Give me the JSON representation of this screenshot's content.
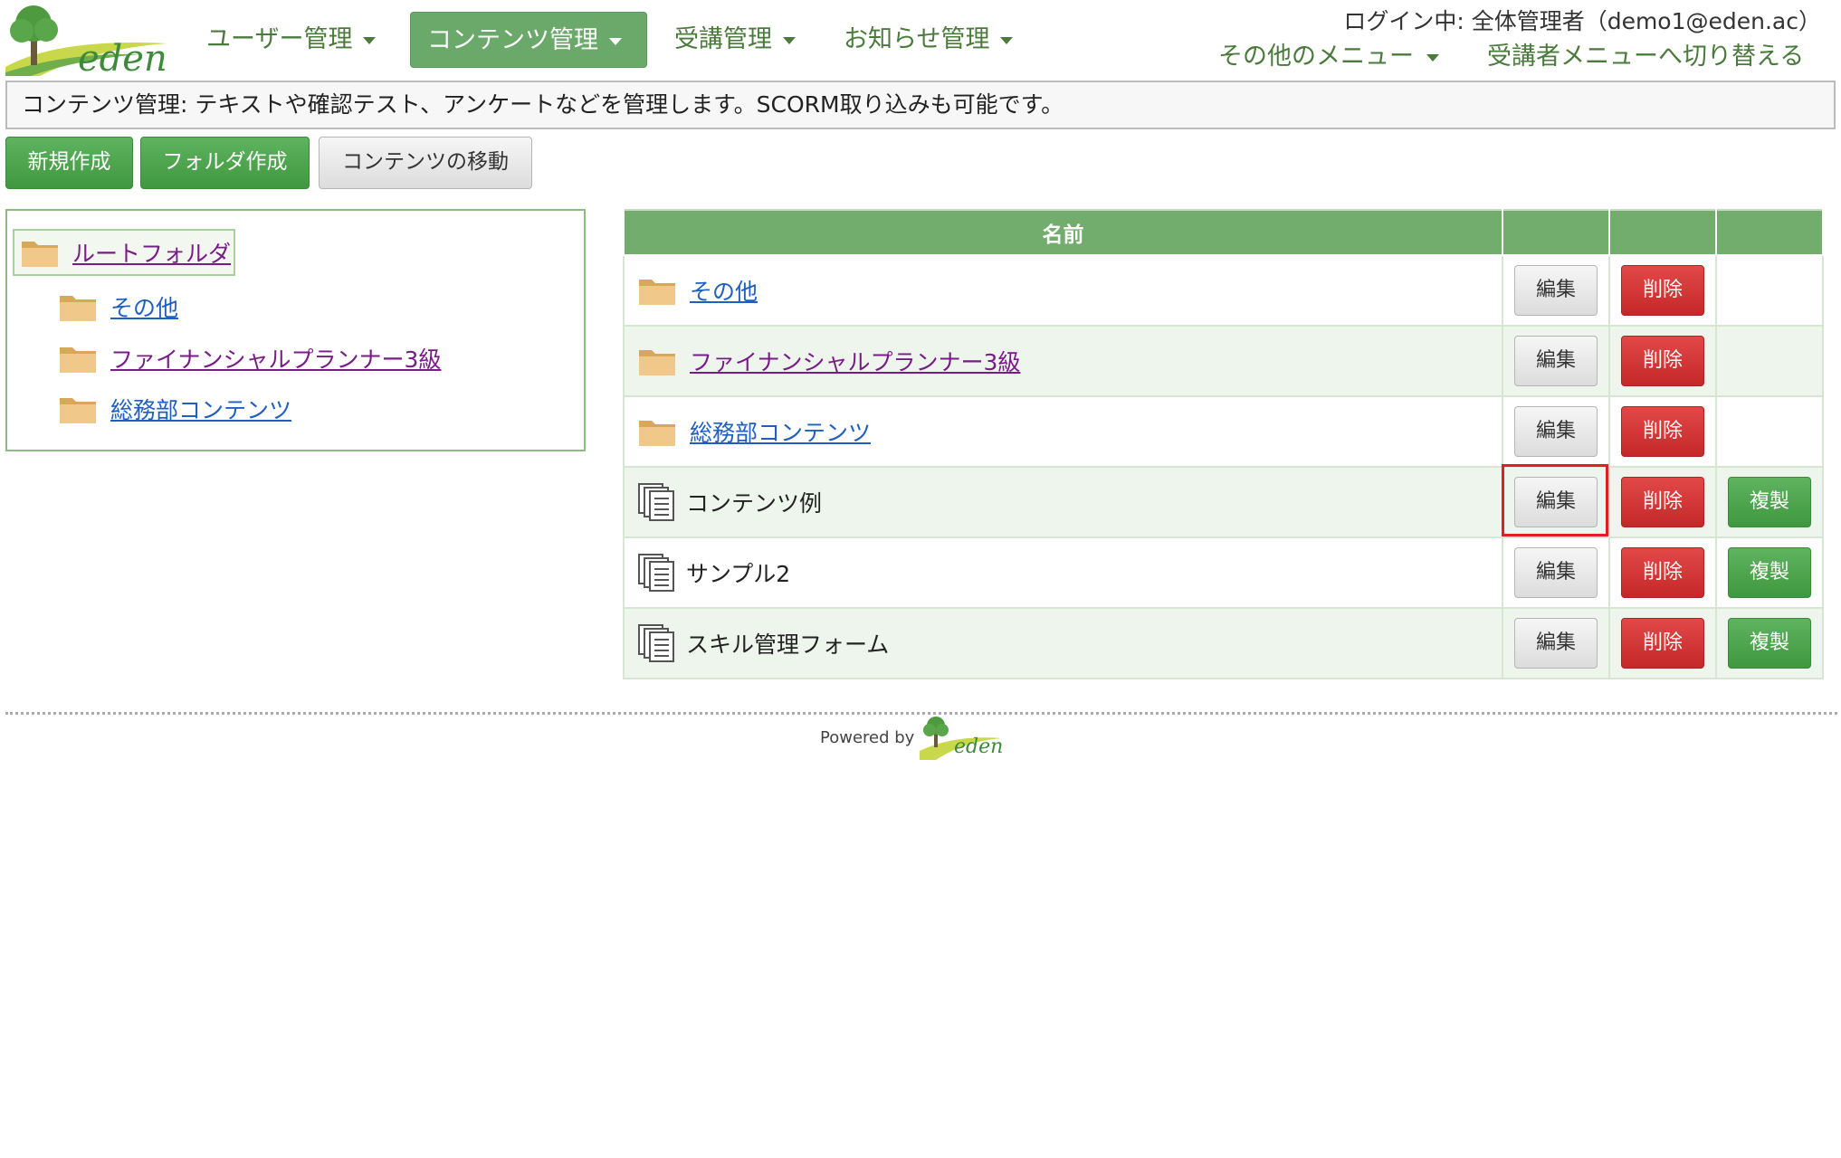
{
  "header": {
    "logo_text": "eden",
    "nav": [
      {
        "label": "ユーザー管理",
        "active": false
      },
      {
        "label": "コンテンツ管理",
        "active": true
      },
      {
        "label": "受講管理",
        "active": false
      },
      {
        "label": "お知らせ管理",
        "active": false
      }
    ],
    "login_info": "ログイン中: 全体管理者（demo1@eden.ac）",
    "other_menu": "その他のメニュー",
    "switch_menu": "受講者メニューへ切り替える"
  },
  "description": "コンテンツ管理: テキストや確認テスト、アンケートなどを管理します。SCORM取り込みも可能です。",
  "actions": {
    "new": "新規作成",
    "new_folder": "フォルダ作成",
    "move": "コンテンツの移動"
  },
  "tree": {
    "root": "ルートフォルダ",
    "children": [
      "その他",
      "ファイナンシャルプランナー3級",
      "総務部コンテンツ"
    ]
  },
  "table": {
    "header_name": "名前",
    "edit_label": "編集",
    "delete_label": "削除",
    "copy_label": "複製",
    "rows": [
      {
        "type": "folder",
        "name": "その他",
        "copy": false
      },
      {
        "type": "folder",
        "name": "ファイナンシャルプランナー3級",
        "copy": false
      },
      {
        "type": "folder",
        "name": "総務部コンテンツ",
        "copy": false
      },
      {
        "type": "content",
        "name": "コンテンツ例",
        "copy": true
      },
      {
        "type": "content",
        "name": "サンプル2",
        "copy": true
      },
      {
        "type": "content",
        "name": "スキル管理フォーム",
        "copy": true
      }
    ]
  },
  "footer": {
    "powered_by": "Powered by",
    "logo_text": "eden"
  },
  "colors": {
    "accent_green": "#6aa96a",
    "danger_red": "#d03535",
    "highlight": "#e02020"
  }
}
